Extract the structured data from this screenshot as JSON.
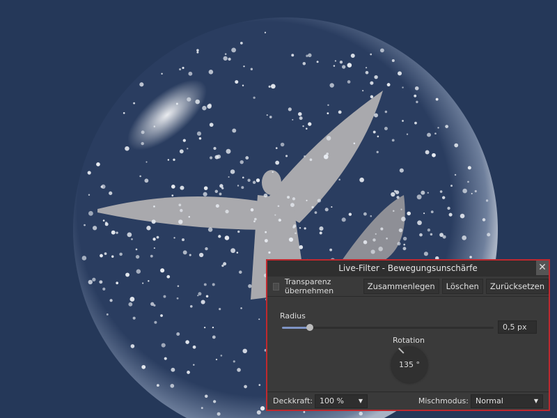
{
  "dialog": {
    "title": "Live-Filter - Bewegungsunschärfe",
    "close_label": "✕",
    "transparency_label": "Transparenz übernehmen",
    "transparency_checked": false,
    "merge_label": "Zusammenlegen",
    "delete_label": "Löschen",
    "reset_label": "Zurücksetzen",
    "radius_label": "Radius",
    "radius_value": "0,5 px",
    "radius_slider_fraction": 0.13,
    "rotation_label": "Rotation",
    "rotation_value": "135 °",
    "opacity_label": "Deckkraft:",
    "opacity_value": "100 %",
    "blend_label": "Mischmodus:",
    "blend_value": "Normal"
  },
  "colors": {
    "background": "#253859",
    "accent_border": "#c0282e"
  }
}
